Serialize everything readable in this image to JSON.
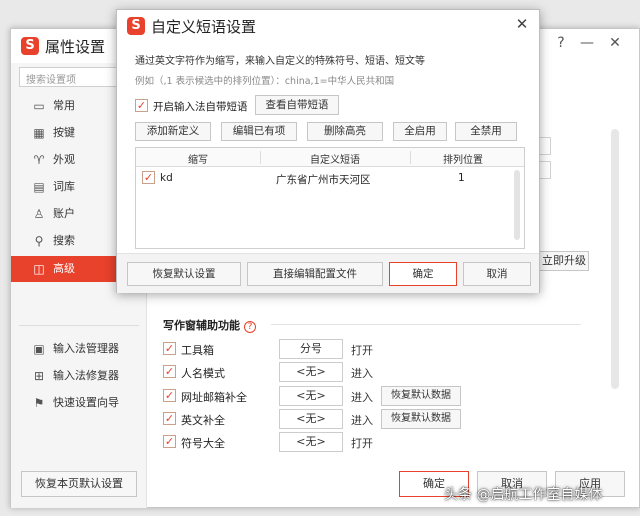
{
  "main_window": {
    "logo": "S",
    "title": "属性设置",
    "help_label": "?",
    "minimize_label": "—",
    "close_label": "✕"
  },
  "sidebar": {
    "search_placeholder": "搜索设置项",
    "items": [
      {
        "label": "常用",
        "icon": "monitor-icon",
        "glyph": "▭"
      },
      {
        "label": "按键",
        "icon": "keyboard-icon",
        "glyph": "▦"
      },
      {
        "label": "外观",
        "icon": "shirt-icon",
        "glyph": "♈"
      },
      {
        "label": "词库",
        "icon": "book-icon",
        "glyph": "▤"
      },
      {
        "label": "账户",
        "icon": "user-icon",
        "glyph": "♙"
      },
      {
        "label": "搜索",
        "icon": "search-icon",
        "glyph": "⚲"
      },
      {
        "label": "高级",
        "icon": "advanced-icon",
        "glyph": "◫"
      }
    ],
    "sub_items": [
      {
        "label": "输入法管理器",
        "icon": "manager-icon",
        "glyph": "▣"
      },
      {
        "label": "输入法修复器",
        "icon": "repair-icon",
        "glyph": "⊞"
      },
      {
        "label": "快速设置向导",
        "icon": "flag-icon",
        "glyph": "⚑"
      }
    ],
    "restore_page_default": "恢复本页默认设置"
  },
  "main_content": {
    "upgrade_button": "立即升级",
    "section_title": "写作窗辅助功能",
    "help_glyph": "?",
    "features": [
      {
        "label": "工具箱",
        "key": "分号",
        "action": "打开",
        "restore": ""
      },
      {
        "label": "人名模式",
        "key": "<无>",
        "action": "进入",
        "restore": ""
      },
      {
        "label": "网址邮箱补全",
        "key": "<无>",
        "action": "进入",
        "restore": "恢复默认数据"
      },
      {
        "label": "英文补全",
        "key": "<无>",
        "action": "进入",
        "restore": "恢复默认数据"
      },
      {
        "label": "符号大全",
        "key": "<无>",
        "action": "打开",
        "restore": ""
      }
    ],
    "ok": "确定",
    "cancel": "取消",
    "apply": "应用"
  },
  "dialog": {
    "logo": "S",
    "title": "自定义短语设置",
    "close_label": "✕",
    "description": "通过英文字符作为缩写，来输入自定义的特殊符号、短语、短文等",
    "example": "例如（,1 表示候选中的排列位置）：china,1=中华人民共和国",
    "enable_label": "开启输入法自带短语",
    "view_builtin": "查看自带短语",
    "toolbar": {
      "add": "添加新定义",
      "edit": "编辑已有项",
      "delete": "删除高亮",
      "enable_all": "全启用",
      "disable_all": "全禁用"
    },
    "columns": {
      "abbr": "缩写",
      "phrase": "自定义短语",
      "position": "排列位置"
    },
    "rows": [
      {
        "checked": "✓",
        "abbr": "kd",
        "phrase": "广东省广州市天河区",
        "position": "1"
      }
    ],
    "footer": {
      "restore_default": "恢复默认设置",
      "edit_config": "直接编辑配置文件",
      "ok": "确定",
      "cancel": "取消"
    }
  },
  "watermark": "头条 @启航工作室自媒体",
  "colors": {
    "accent": "#e8412c",
    "checkbox_border": "#c9a08c"
  }
}
